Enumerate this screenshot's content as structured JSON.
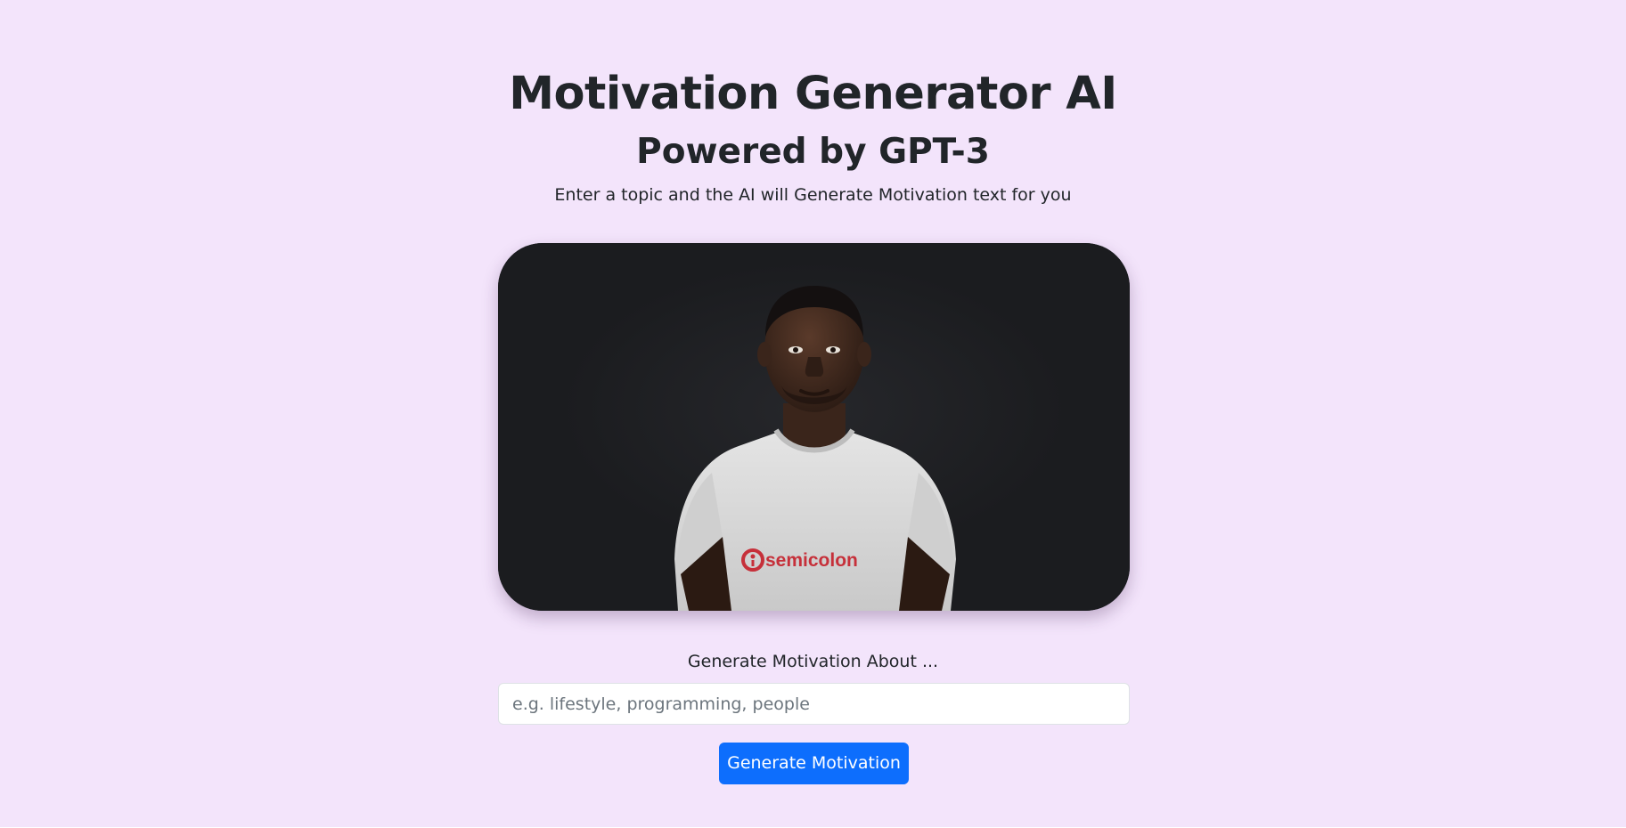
{
  "header": {
    "title": "Motivation Generator AI",
    "subtitle": "Powered by GPT-3",
    "lead": "Enter a topic and the AI will Generate Motivation text for you"
  },
  "hero": {
    "shirt_logo_text": "semicolon",
    "colors": {
      "background": "#1b1c1f",
      "shirt": "#d9d9d9",
      "logo_red": "#c6303a"
    }
  },
  "form": {
    "label": "Generate Motivation About ...",
    "input_value": "",
    "input_placeholder": "e.g. lifestyle, programming, people",
    "button_label": "Generate Motivation"
  },
  "theme": {
    "page_background": "#f3e4fb",
    "primary": "#0d6efd",
    "text": "#212529"
  }
}
